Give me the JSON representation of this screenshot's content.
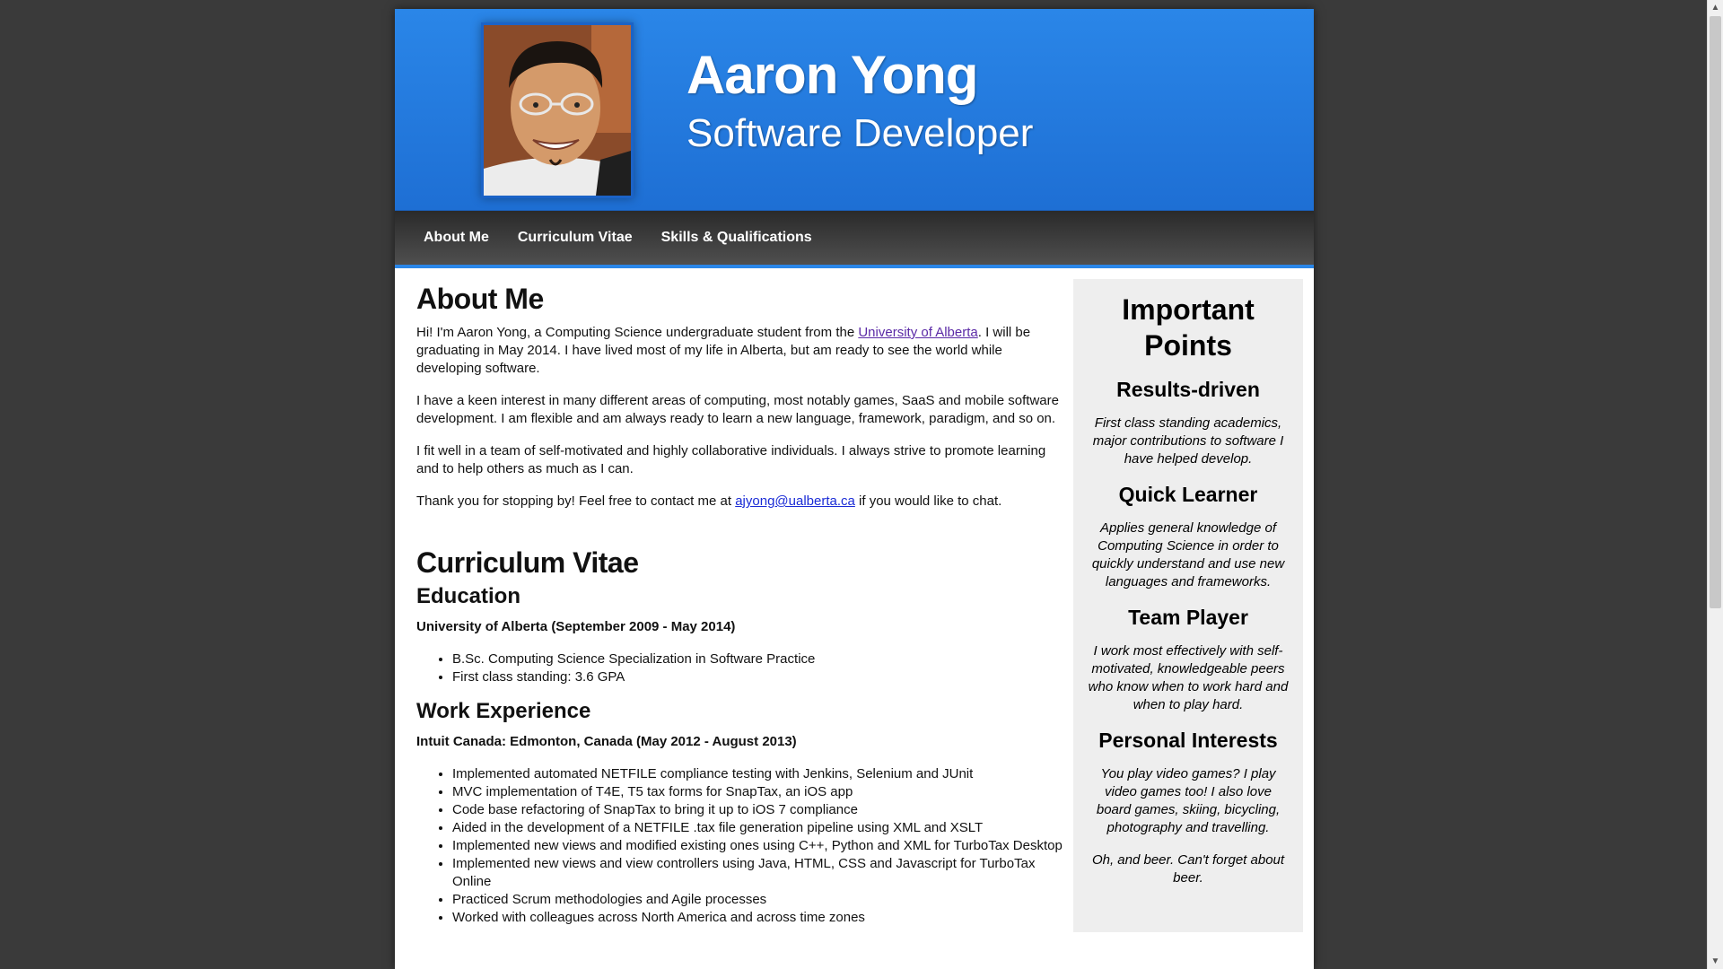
{
  "header": {
    "name": "Aaron Yong",
    "tagline": "Software Developer"
  },
  "nav": {
    "items": [
      {
        "label": "About Me"
      },
      {
        "label": "Curriculum Vitae"
      },
      {
        "label": "Skills & Qualifications"
      }
    ]
  },
  "about": {
    "title": "About Me",
    "p1_before": "Hi! I'm Aaron Yong, a Computing Science undergraduate student from the ",
    "p1_link": "University of Alberta",
    "p1_after": ". I will be graduating in May 2014. I have lived most of my life in Alberta, but am ready to see the world while developing software.",
    "p2": "I have a keen interest in many different areas of computing, most notably games, SaaS and mobile software development. I am flexible and am always ready to learn a new language, framework, paradigm, and so on.",
    "p3": "I fit well in a team of self-motivated and highly collaborative individuals. I always strive to promote learning and to help others as much as I can.",
    "p4_before": "Thank you for stopping by! Feel free to contact me at ",
    "p4_email": "ajyong@ualberta.ca",
    "p4_after": " if you would like to chat."
  },
  "cv": {
    "title": "Curriculum Vitae",
    "education": {
      "heading": "Education",
      "org": "University of Alberta (September 2009 - May 2014)",
      "items": [
        "B.Sc. Computing Science Specialization in Software Practice",
        "First class standing: 3.6 GPA"
      ]
    },
    "work": {
      "heading": "Work Experience",
      "org": "Intuit Canada: Edmonton, Canada (May 2012 - August 2013)",
      "items": [
        "Implemented automated NETFILE compliance testing with Jenkins, Selenium and JUnit",
        "MVC implementation of T4E, T5 tax forms for SnapTax, an iOS app",
        "Code base refactoring of SnapTax to bring it up to iOS 7 compliance",
        "Aided in the development of a NETFILE .tax file generation pipeline using XML and XSLT",
        "Implemented new views and modified existing ones using C++, Python and XML for TurboTax Desktop",
        "Implemented new views and view controllers using Java, HTML, CSS and Javascript for TurboTax Online",
        "Practiced Scrum methodologies and Agile processes",
        "Worked with colleagues across North America and across time zones"
      ]
    }
  },
  "sidebar": {
    "title": "Important Points",
    "points": [
      {
        "heading": "Results-driven",
        "text": "First class standing academics, major contributions to software I have helped develop."
      },
      {
        "heading": "Quick Learner",
        "text": "Applies general knowledge of Computing Science in order to quickly understand and use new languages and frameworks."
      },
      {
        "heading": "Team Player",
        "text": "I work most effectively with self-motivated, knowledgeable peers who know when to work hard and when to play hard."
      },
      {
        "heading": "Personal Interests",
        "text": "You play video games? I play video games too! I also love board games, skiing, bicycling, photography and travelling."
      }
    ],
    "footer": "Oh, and beer. Can't forget about beer."
  }
}
